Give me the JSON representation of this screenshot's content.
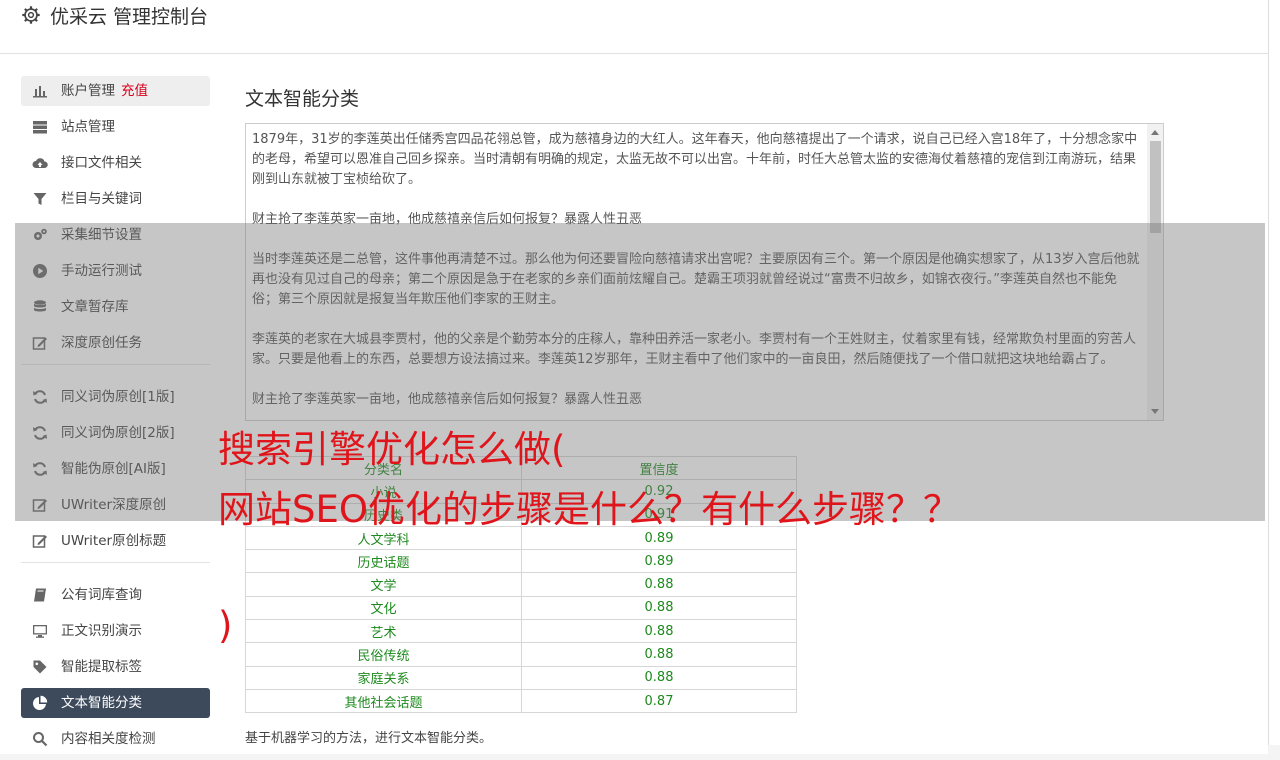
{
  "header": {
    "app_title": "优采云 管理控制台",
    "icon": "gear-icon"
  },
  "sidebar": {
    "items": [
      {
        "label": "账户管理",
        "badge": "充值",
        "icon": "bar-chart-icon"
      },
      {
        "label": "站点管理",
        "icon": "server-icon"
      },
      {
        "label": "接口文件相关",
        "icon": "cloud-upload-icon"
      },
      {
        "label": "栏目与关键词",
        "icon": "filter-icon"
      },
      {
        "label": "采集细节设置",
        "icon": "cogs-icon"
      },
      {
        "label": "手动运行测试",
        "icon": "play-circle-icon"
      },
      {
        "label": "文章暂存库",
        "icon": "database-icon"
      },
      {
        "label": "深度原创任务",
        "icon": "edit-icon"
      },
      {
        "label": "同义词伪原创[1版]",
        "icon": "refresh-icon"
      },
      {
        "label": "同义词伪原创[2版]",
        "icon": "refresh-icon"
      },
      {
        "label": "智能伪原创[AI版]",
        "icon": "refresh-icon"
      },
      {
        "label": "UWriter深度原创",
        "icon": "edit-icon"
      },
      {
        "label": "UWriter原创标题",
        "icon": "edit-icon"
      },
      {
        "label": "公有词库查询",
        "icon": "book-icon"
      },
      {
        "label": "正文识别演示",
        "icon": "monitor-icon"
      },
      {
        "label": "智能提取标签",
        "icon": "tag-icon"
      },
      {
        "label": "文本智能分类",
        "icon": "pie-chart-icon"
      },
      {
        "label": "内容相关度检测",
        "icon": "search-icon"
      }
    ]
  },
  "main": {
    "title": "文本智能分类",
    "text_paragraphs": [
      "1879年，31岁的李莲英出任储秀宫四品花翎总管，成为慈禧身边的大红人。这年春天，他向慈禧提出了一个请求，说自己已经入宫18年了，十分想念家中的老母，希望可以恩准自己回乡探亲。当时清朝有明确的规定，太监无故不可以出宫。十年前，时任大总管太监的安德海仗着慈禧的宠信到江南游玩，结果刚到山东就被丁宝桢给砍了。",
      "财主抢了李莲英家一亩地，他成慈禧亲信后如何报复？暴露人性丑恶",
      "当时李莲英还是二总管，这件事他再清楚不过。那么他为何还要冒险向慈禧请求出宫呢？主要原因有三个。第一个原因是他确实想家了，从13岁入宫后他就再也没有见过自己的母亲；第二个原因是急于在老家的乡亲们面前炫耀自己。楚霸王项羽就曾经说过“富贵不归故乡，如锦衣夜行。”李莲英自然也不能免俗；第三个原因就是报复当年欺压他们李家的王财主。",
      "李莲英的老家在大城县李贾村，他的父亲是个勤劳本分的庄稼人，靠种田养活一家老小。李贾村有一个王姓财主，仗着家里有钱，经常欺负村里面的穷苦人家。只要是他看上的东西，总要想方设法搞过来。李莲英12岁那年，王财主看中了他们家中的一亩良田，然后随便找了一个借口就把这块地给霸占了。",
      "财主抢了李莲英家一亩地，他成慈禧亲信后如何报复？暴露人性丑恶"
    ],
    "table": {
      "headers": [
        "分类名",
        "置信度"
      ],
      "rows": [
        [
          "小说",
          "0.92"
        ],
        [
          "历史类",
          "0.91"
        ],
        [
          "人文学科",
          "0.89"
        ],
        [
          "历史话题",
          "0.89"
        ],
        [
          "文学",
          "0.88"
        ],
        [
          "文化",
          "0.88"
        ],
        [
          "艺术",
          "0.88"
        ],
        [
          "民俗传统",
          "0.88"
        ],
        [
          "家庭关系",
          "0.88"
        ],
        [
          "其他社会话题",
          "0.87"
        ]
      ]
    },
    "footnote": "基于机器学习的方法，进行文本智能分类。"
  },
  "overlay": {
    "line1": "搜索引擎优化怎么做(",
    "line2": "网站SEO优化的步骤是什么？有什么步骤？？",
    "line3": ")"
  }
}
